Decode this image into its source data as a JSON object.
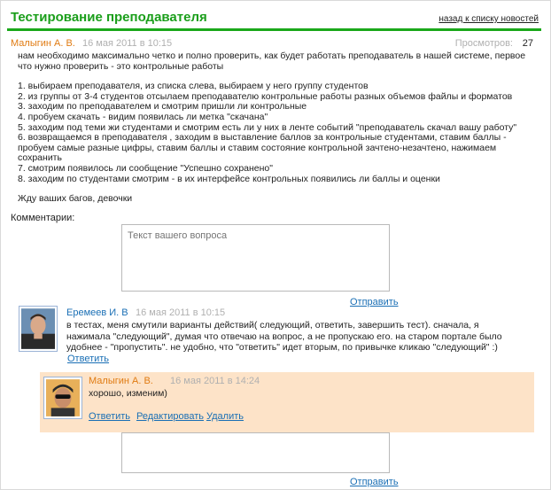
{
  "header": {
    "title": "Тестирование преподавателя",
    "back_link": "назад к списку новостей",
    "accent_color": "#1aa81a"
  },
  "post": {
    "author": "Малыгин А. В.",
    "date": "16 мая 2011 в 10:15",
    "views_label": "Просмотров:",
    "views_count": "27",
    "intro": "нам необходимо максимально четко и полно проверить, как будет работать преподаватель в нашей системе, первое что нужно проверить - это контрольные работы",
    "steps": [
      "1. выбираем преподавателя, из списка слева, выбираем у него группу студентов",
      "2. из группы от 3-4 студентов отсылаем преподавателю контрольные работы разных объемов файлы и форматов",
      "3. заходим по преподавателем и смотрим пришли ли контрольные",
      "4. пробуем скачать - видим появилась ли метка \"скачана\"",
      "5. заходим под теми жи студентами и смотрим есть ли у них в ленте событий \"преподаватель скачал вашу работу\"",
      "6. возвращаемся в преподавателя , заходим в выставление баллов за контрольные студентами, ставим баллы - пробуем самые разные цифры, ставим баллы и ставим состояние контрольной зачтено-незачтено, нажимаем сохранить",
      "7. смотрим появилось ли сообщение \"Успешно сохранено\"",
      "8. заходим по студентами смотрим - в их интерфейсе контрольных появились ли баллы и оценки"
    ],
    "closing": "Жду ваших багов, девочки"
  },
  "comments": {
    "label": "Комментарии:",
    "input_placeholder": "Текст вашего вопроса",
    "send_label": "Отправить",
    "items": [
      {
        "author": "Еремеев И. В",
        "date": "16 мая 2011 в 10:15",
        "text": "в тестах, меня смутили варианты действий( следующий, ответить, завершить тест). сначала, я нажимала \"следующий\", думая что отвечаю на вопрос, а не пропускаю его. на старом портале было удобнее - \"пропустить\". не удобно, что \"ответить\" идет вторым, по привычке кликаю \"следующий\" :)",
        "reply_label": "Ответить",
        "reply": {
          "author": "Малыгин А. В.",
          "date": "16 мая 2011 в 14:24",
          "text": "хорошо, изменим)",
          "actions": [
            "Ответить",
            "Редактировать",
            "Удалить"
          ],
          "bg_color": "#fde3c8"
        }
      }
    ],
    "reply_input_placeholder": "",
    "reply_send_label": "Отправить"
  }
}
